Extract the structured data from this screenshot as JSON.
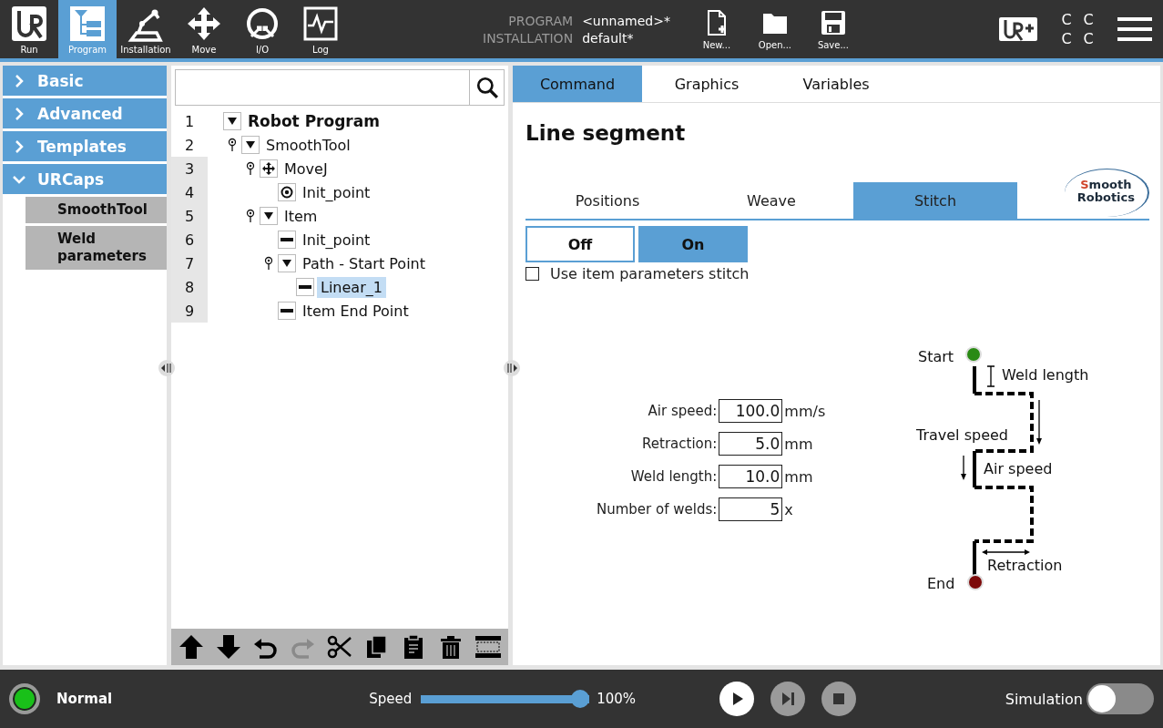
{
  "header": {
    "nav": [
      {
        "label": "Run",
        "selected": false
      },
      {
        "label": "Program",
        "selected": true
      },
      {
        "label": "Installation",
        "selected": false
      },
      {
        "label": "Move",
        "selected": false
      },
      {
        "label": "I/O",
        "selected": false
      },
      {
        "label": "Log",
        "selected": false
      }
    ],
    "program_label": "PROGRAM",
    "program_value": "<unnamed>*",
    "installation_label": "INSTALLATION",
    "installation_value": "default*",
    "file_buttons": [
      {
        "label": "New..."
      },
      {
        "label": "Open..."
      },
      {
        "label": "Save..."
      }
    ],
    "status_letters": [
      "C",
      "C",
      "C",
      "C"
    ]
  },
  "sidebar": {
    "items": [
      {
        "label": "Basic",
        "expanded": false
      },
      {
        "label": "Advanced",
        "expanded": false
      },
      {
        "label": "Templates",
        "expanded": false
      },
      {
        "label": "URCaps",
        "expanded": true,
        "children": [
          {
            "label": "SmoothTool"
          },
          {
            "label": "Weld parameters"
          }
        ]
      }
    ]
  },
  "tree": {
    "nodes": [
      {
        "line": "1",
        "label": "Robot Program",
        "kind": "program",
        "expanded": true,
        "selected": false,
        "shaded": false,
        "children": [
          {
            "line": "2",
            "label": "SmoothTool",
            "kind": "folder",
            "expanded": true,
            "selected": false,
            "shaded": false,
            "children": [
              {
                "line": "3",
                "label": "MoveJ",
                "kind": "move",
                "selected": false,
                "shaded": true,
                "children": [
                  {
                    "line": "4",
                    "label": "Init_point",
                    "kind": "waypoint",
                    "selected": false,
                    "shaded": true
                  }
                ]
              },
              {
                "line": "5",
                "label": "Item",
                "kind": "folder",
                "expanded": true,
                "selected": false,
                "shaded": true,
                "children": [
                  {
                    "line": "6",
                    "label": "Init_point",
                    "kind": "segment",
                    "selected": false,
                    "shaded": true
                  },
                  {
                    "line": "7",
                    "label": "Path - Start Point",
                    "kind": "folder",
                    "expanded": true,
                    "selected": false,
                    "shaded": true,
                    "children": [
                      {
                        "line": "8",
                        "label": "Linear_1",
                        "kind": "segment",
                        "selected": true,
                        "shaded": true
                      }
                    ]
                  },
                  {
                    "line": "9",
                    "label": "Item End Point",
                    "kind": "segment",
                    "selected": false,
                    "shaded": true
                  }
                ]
              }
            ]
          }
        ]
      }
    ],
    "toolbar": [
      {
        "kind": "up",
        "disabled": false
      },
      {
        "kind": "down",
        "disabled": false
      },
      {
        "kind": "undo",
        "disabled": false
      },
      {
        "kind": "redo",
        "disabled": true
      },
      {
        "kind": "cut",
        "disabled": false
      },
      {
        "kind": "copy",
        "disabled": false
      },
      {
        "kind": "paste",
        "disabled": false
      },
      {
        "kind": "delete",
        "disabled": false
      },
      {
        "kind": "suppress",
        "disabled": false
      }
    ]
  },
  "panel": {
    "tabs": [
      {
        "label": "Command",
        "selected": true
      },
      {
        "label": "Graphics",
        "selected": false
      },
      {
        "label": "Variables",
        "selected": false
      }
    ],
    "title": "Line segment",
    "subtabs": [
      {
        "label": "Positions",
        "selected": false
      },
      {
        "label": "Weave",
        "selected": false
      },
      {
        "label": "Stitch",
        "selected": true
      }
    ],
    "logo": {
      "first_letter": "S",
      "rest": "mooth",
      "second": "Robotics"
    },
    "toggle": [
      {
        "label": "Off",
        "selected": false
      },
      {
        "label": "On",
        "selected": true
      }
    ],
    "checkbox": {
      "label": "Use item parameters stitch",
      "checked": false
    },
    "fields": [
      {
        "label": "Air speed:",
        "value": "100.0",
        "unit": "mm/s"
      },
      {
        "label": "Retraction:",
        "value": "5.0",
        "unit": "mm"
      },
      {
        "label": "Weld length:",
        "value": "10.0",
        "unit": "mm"
      },
      {
        "label": "Number of welds:",
        "value": "5",
        "unit": "x"
      }
    ],
    "diagram": {
      "start": "Start",
      "weld_length": "Weld length",
      "travel_speed": "Travel speed",
      "air_speed": "Air speed",
      "retraction": "Retraction",
      "end": "End"
    }
  },
  "footer": {
    "status": "Normal",
    "speed_label": "Speed",
    "speed": {
      "level": 1.0
    },
    "speed_reading": "100%",
    "controls": [
      {
        "kind": "play",
        "disabled": false
      },
      {
        "kind": "step",
        "disabled": true
      },
      {
        "kind": "stop",
        "disabled": true
      }
    ],
    "simulation": {
      "label": "Simulation",
      "on": false
    }
  }
}
